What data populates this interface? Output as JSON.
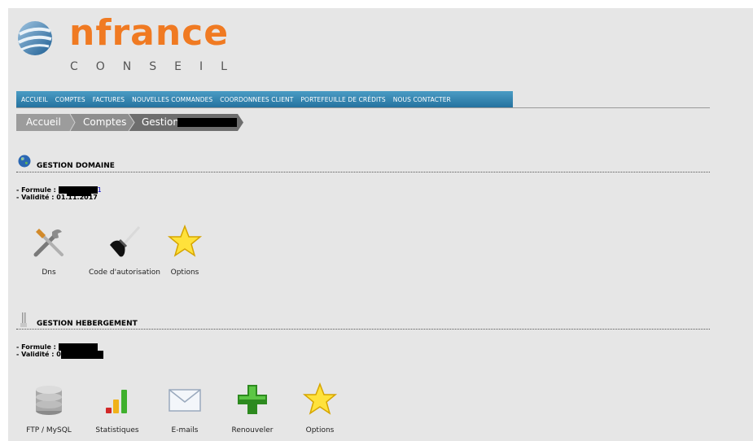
{
  "brand": {
    "name": "nfrance",
    "tagline": "CONSEIL"
  },
  "nav": {
    "items": [
      "ACCUEIL",
      "COMPTES",
      "FACTURES",
      "NOUVELLES COMMANDES",
      "COORDONNEES CLIENT",
      "PORTEFEUILLE DE CRÉDITS",
      "NOUS CONTACTER"
    ]
  },
  "breadcrumb": {
    "items": [
      "Accueil",
      "Comptes",
      "Gestion"
    ]
  },
  "domain_section": {
    "title": "GESTION DOMAINE",
    "formule_label": "- Formule :",
    "formule_suffix": "1",
    "validite_label": "- Validité :",
    "validite_value": "01.11.2017",
    "actions": [
      {
        "label": "Dns",
        "icon": "tools-icon"
      },
      {
        "label": "Code d'autorisation",
        "icon": "plunger-icon"
      },
      {
        "label": "Options",
        "icon": "star-icon"
      }
    ]
  },
  "hosting_section": {
    "title": "GESTION HEBERGEMENT",
    "formule_label": "- Formule :",
    "validite_label": "- Validité :",
    "validite_value": "0",
    "actions": [
      {
        "label": "FTP / MySQL",
        "icon": "database-icon"
      },
      {
        "label": "Statistiques",
        "icon": "bar-chart-icon"
      },
      {
        "label": "E-mails",
        "icon": "envelope-icon"
      },
      {
        "label": "Renouveler",
        "icon": "plus-icon"
      },
      {
        "label": "Options",
        "icon": "star-icon"
      }
    ]
  },
  "colors": {
    "brand_orange": "#f07a22",
    "nav_blue": "#2f7fab",
    "page_bg": "#e6e6e6",
    "breadcrumb_gray": "#9c9c9c",
    "breadcrumb_active": "#6e6e6e"
  }
}
